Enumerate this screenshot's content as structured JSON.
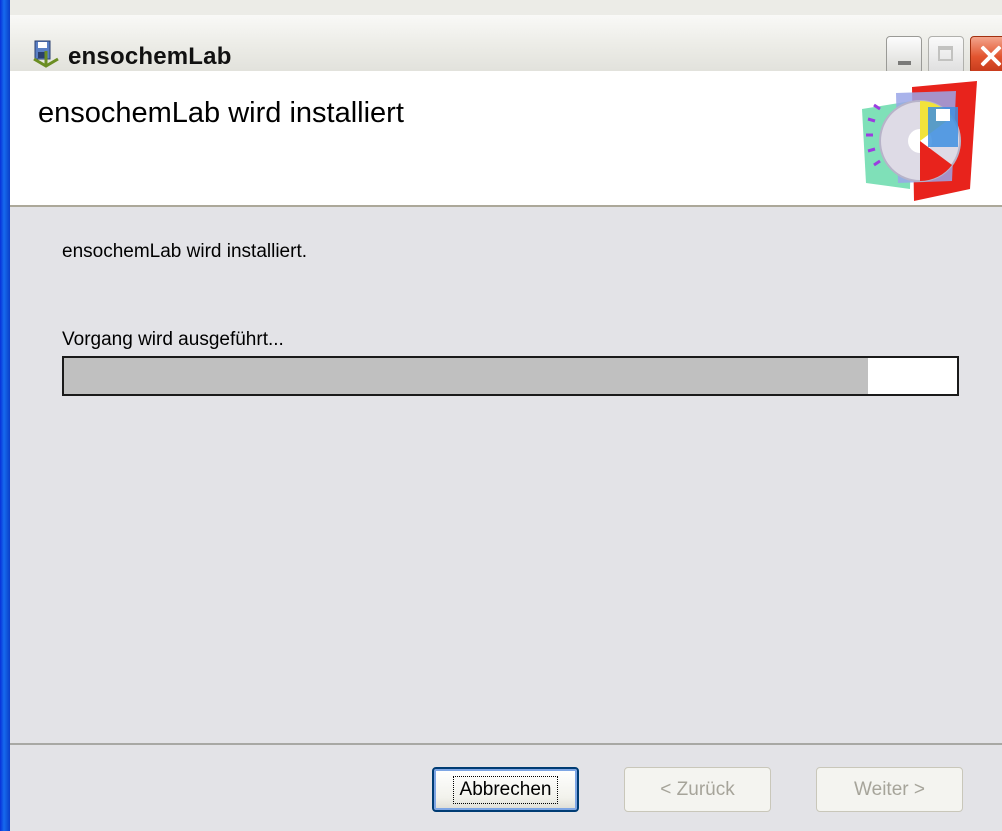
{
  "window": {
    "title": "ensochemLab",
    "icon": "installer-icon",
    "controls": [
      "minimize-icon",
      "maximize-icon",
      "close-icon"
    ]
  },
  "banner": {
    "heading": "ensochemLab wird installiert",
    "logo": "setup-disk-logo"
  },
  "content": {
    "status": "ensochemLab wird installiert.",
    "action": "Vorgang wird ausgeführt...",
    "progress": 0.9
  },
  "footer": {
    "cancel_label": "Abbrechen",
    "back_label": "< Zurück",
    "next_label": "Weiter >"
  },
  "colors": {
    "content_bg": "#e3e3e7",
    "progress_fill": "#c0c0c0",
    "disabled_text": "#a6a49a"
  }
}
